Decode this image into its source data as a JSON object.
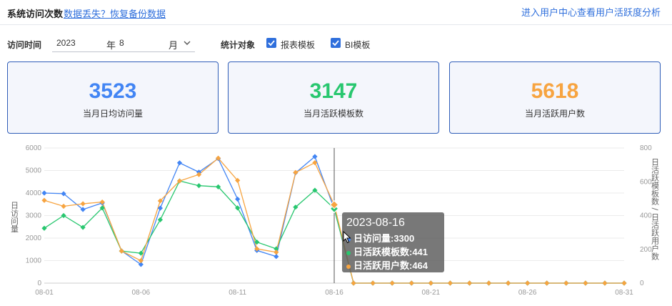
{
  "header": {
    "title": "系统访问次数",
    "restore_link": "数据丢失？恢复备份数据",
    "right_link": "进入用户中心查看用户活跃度分析"
  },
  "filters": {
    "time_label": "访问时间",
    "year": "2023",
    "year_unit": "年",
    "month": "8",
    "month_unit": "月",
    "target_label": "统计对象",
    "checkbox_1": "报表模板",
    "checkbox_2": "BI模板"
  },
  "kpis": [
    {
      "value": "3523",
      "caption": "当月日均访问量",
      "color": "#4285f4"
    },
    {
      "value": "3147",
      "caption": "当月活跃模板数",
      "color": "#28c76f"
    },
    {
      "value": "5618",
      "caption": "当月活跃用户数",
      "color": "#f7a440"
    }
  ],
  "tooltip": {
    "date": "2023-08-16",
    "row1": "日访问量:3300",
    "row2": "日活跃模板数:441",
    "row3": "日活跃用户数:464"
  },
  "chart_data": {
    "type": "line",
    "x": [
      "08-01",
      "08-02",
      "08-03",
      "08-04",
      "08-05",
      "08-06",
      "08-07",
      "08-08",
      "08-09",
      "08-10",
      "08-11",
      "08-12",
      "08-13",
      "08-14",
      "08-15",
      "08-16",
      "08-17",
      "08-18",
      "08-19",
      "08-20",
      "08-21",
      "08-22",
      "08-23",
      "08-24",
      "08-25",
      "08-26",
      "08-27",
      "08-28",
      "08-29",
      "08-30",
      "08-31"
    ],
    "x_ticks": [
      "08-01",
      "08-06",
      "08-11",
      "08-16",
      "08-21",
      "08-26",
      "08-31"
    ],
    "ylabel_left": "日访问量",
    "ylabel_right": "日活跃模板数 / 日活跃用户数",
    "ylim_left": [
      0,
      6000
    ],
    "ylim_right": [
      0,
      800
    ],
    "yticks_left": [
      "0",
      "1000",
      "2000",
      "3000",
      "4000",
      "5000",
      "6000"
    ],
    "yticks_right": [
      "0",
      "200",
      "400",
      "600",
      "800"
    ],
    "series": [
      {
        "key": "visits",
        "axis": "left",
        "color": "#4285f4",
        "values": [
          4000,
          3970,
          3270,
          3560,
          1430,
          830,
          3330,
          5340,
          4930,
          5530,
          3730,
          1450,
          1180,
          4900,
          5620,
          3300,
          0,
          0,
          0,
          0,
          0,
          0,
          0,
          0,
          0,
          0,
          0,
          0,
          0,
          0,
          0
        ]
      },
      {
        "key": "templates",
        "axis": "right",
        "color": "#28c76f",
        "values": [
          325,
          400,
          330,
          445,
          190,
          177,
          375,
          605,
          577,
          570,
          445,
          243,
          203,
          450,
          550,
          441,
          0,
          0,
          0,
          0,
          0,
          0,
          0,
          0,
          0,
          0,
          0,
          0,
          0,
          0,
          0
        ]
      },
      {
        "key": "users",
        "axis": "right",
        "color": "#f7a440",
        "values": [
          490,
          455,
          470,
          480,
          190,
          133,
          487,
          605,
          643,
          740,
          608,
          203,
          183,
          655,
          713,
          464,
          0,
          0,
          0,
          0,
          0,
          0,
          0,
          0,
          0,
          0,
          0,
          0,
          0,
          0,
          0
        ]
      }
    ],
    "hover_index": 15,
    "grid": true
  }
}
